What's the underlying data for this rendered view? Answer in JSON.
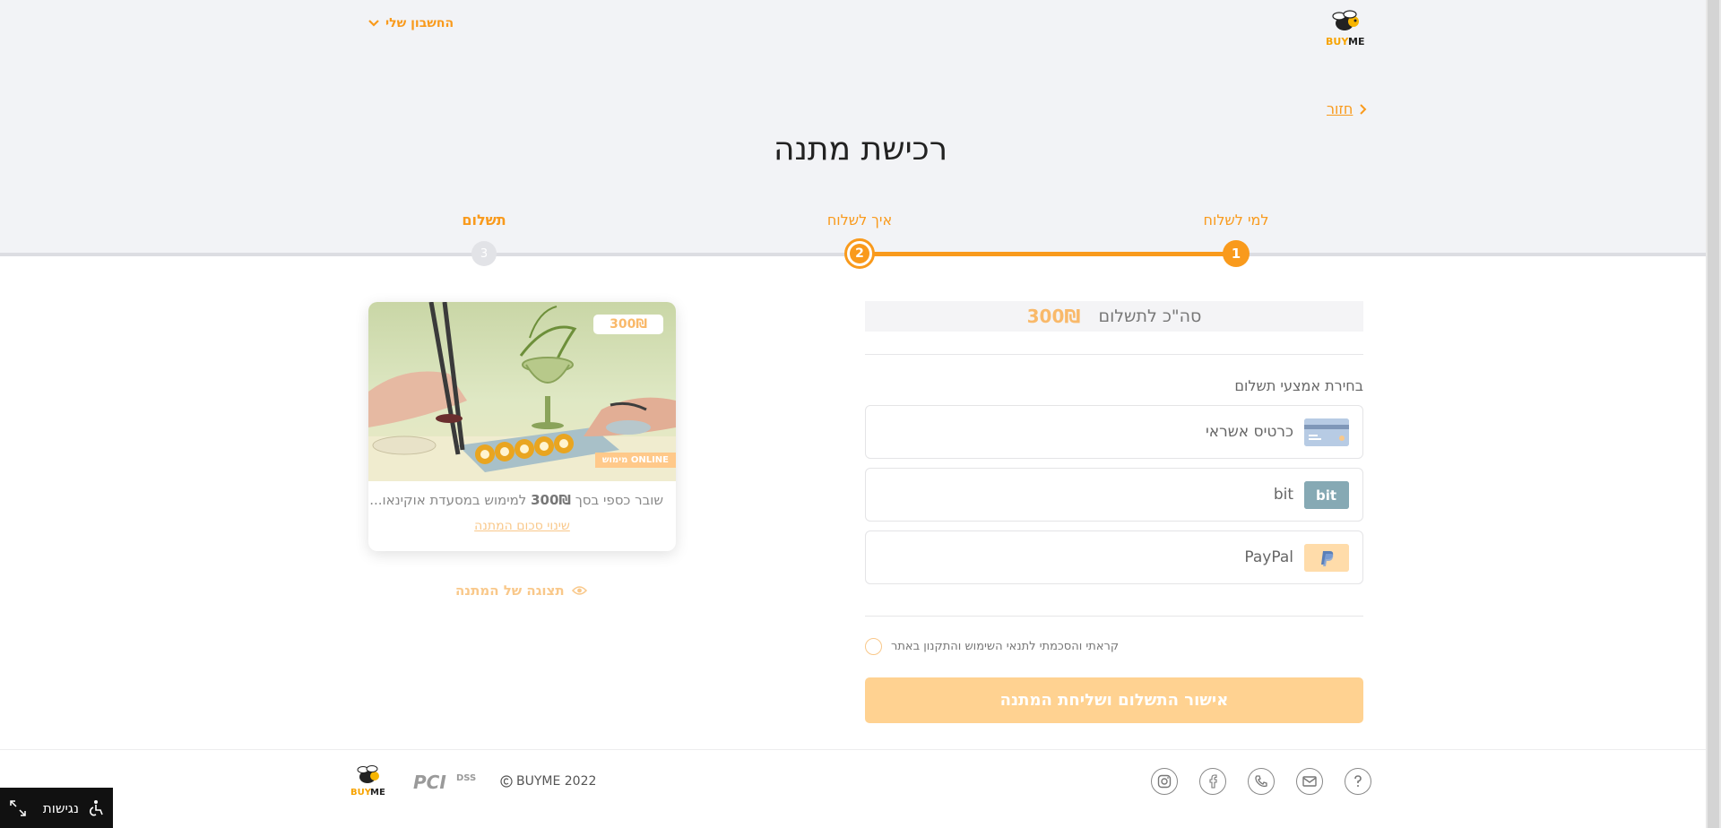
{
  "header": {
    "account_label": "החשבון שלי",
    "logo_text_buy": "BUY",
    "logo_text_me": "ME",
    "back_label": "חזור",
    "page_title": "רכישת מתנה"
  },
  "steps": [
    {
      "label": "למי לשלוח",
      "number": "1"
    },
    {
      "label": "איך לשלוח",
      "number": "2"
    },
    {
      "label": "תשלום",
      "number": "3"
    }
  ],
  "payment": {
    "total_label": "סה\"כ לתשלום",
    "total_amount": "300₪",
    "methods_title": "בחירת אמצעי תשלום",
    "methods": [
      {
        "label": "כרטיס אשראי",
        "icon": "credit-card-icon"
      },
      {
        "label": "bit",
        "icon": "bit-icon"
      },
      {
        "label": "PayPal",
        "icon": "paypal-icon"
      }
    ],
    "terms_label": "קראתי והסכמתי לתנאי השימוש והתקנון באתר",
    "submit_label": "אישור התשלום ושליחת המתנה"
  },
  "gift_card": {
    "price_badge": "300₪",
    "online_tag": "מימוש ONLINE",
    "desc_prefix": "שובר כספי בסך",
    "desc_amount": "300₪",
    "desc_suffix": "למימוש במסעדת אוקינאו...",
    "change_amount_label": "שינוי סכום המתנה",
    "preview_label": "תצוגה של המתנה"
  },
  "footer": {
    "copyright": "BUYME 2022",
    "social_icons": [
      "help-icon",
      "mail-icon",
      "phone-icon",
      "facebook-icon",
      "instagram-icon"
    ],
    "pci_text": "PCI",
    "pci_dss": "DSS"
  },
  "accessibility": {
    "label": "נגישות"
  },
  "colors": {
    "brand_orange": "#f99a1c",
    "disabled_orange": "#ffd291",
    "background_top": "#f2f3f6"
  }
}
